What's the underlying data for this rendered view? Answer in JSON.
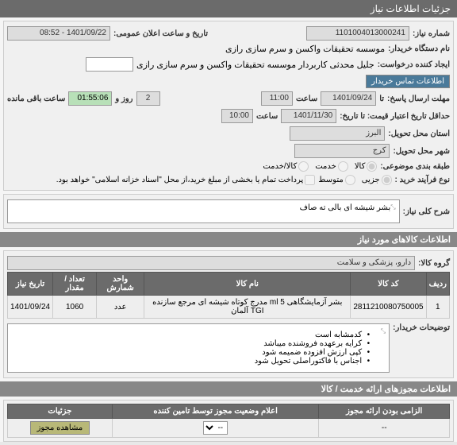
{
  "header": {
    "title": "جزئیات اطلاعات نیاز"
  },
  "fields": {
    "need_no_label": "شماره نیاز:",
    "need_no": "1101004013000241",
    "announce_label": "تاریخ و ساعت اعلان عمومی:",
    "announce": "1401/09/22 - 08:52",
    "buyer_label": "نام دستگاه خریدار:",
    "buyer": "موسسه تحقیقات واکسن و سرم سازی رازی",
    "requester_label": "ایجاد کننده درخواست:",
    "requester": "جلیل محدثی کاربردار موسسه تحقیقات واکسن و سرم سازی رازی",
    "contact_btn": "اطلاعات تماس خریدار",
    "deadline_label": "مهلت ارسال پاسخ:",
    "deadline_date": "1401/09/24",
    "time_label": "ساعت",
    "deadline_time": "11:00",
    "days_label": "روز و",
    "days": "2",
    "remain_label": "ساعت باقی مانده",
    "remain_time": "01:55:06",
    "ta_label": "تا",
    "credit_label": "حداقل تاریخ اعتبار قیمت: تا تاریخ:",
    "credit_date": "1401/11/30",
    "credit_time": "10:00",
    "province_label": "استان محل تحویل:",
    "province": "البرز",
    "city_label": "شهر محل تحویل:",
    "city": "کرج",
    "category_label": "طبقه بندی موضوعی:",
    "cat_goods": "کالا",
    "cat_service": "خدمت",
    "cat_both": "کالا/خدمت",
    "purchase_type_label": "نوع فرآیند خرید :",
    "pt_low": "جزیی",
    "pt_mid": "متوسط",
    "pt_note": "پرداخت تمام یا بخشی از مبلغ خرید،از محل \"اسناد خزانه اسلامی\" خواهد بود."
  },
  "need_desc": {
    "label": "شرح کلی نیاز:",
    "text": "بشر شیشه ای بالی ته صاف"
  },
  "goods_header": "اطلاعات کالاهای مورد نیاز",
  "goods_group": {
    "label": "گروه کالا:",
    "value": "دارو، پزشکی و سلامت"
  },
  "table": {
    "headers": [
      "ردیف",
      "کد کالا",
      "نام کالا",
      "واحد شمارش",
      "تعداد / مقدار",
      "تاریخ نیاز"
    ],
    "rows": [
      {
        "idx": "1",
        "code": "2811210080750005",
        "name": "بشر آزمایشگاهی 5 ml مدرج کوتاه شیشه ای مرجع سازنده TGI آلمان",
        "unit": "عدد",
        "qty": "1060",
        "date": "1401/09/24"
      }
    ]
  },
  "buyer_notes": {
    "label": "توضیحات خریدار:",
    "items": [
      "کدمشابه است",
      "کرایه برعهده فروشنده میباشد",
      "کپی ارزش افزوده ضمیمه شود",
      "اجناس با فاکتوراصلی تحویل شود"
    ]
  },
  "license_header": "اطلاعات مجوزهای ارائه خدمت / کالا",
  "license_table": {
    "headers": [
      "الزامی بودن ارائه مجوز",
      "اعلام وضعیت مجوز توسط تامین کننده",
      "جزئیات"
    ],
    "btn": "مشاهده مجوز",
    "dash": "--"
  }
}
